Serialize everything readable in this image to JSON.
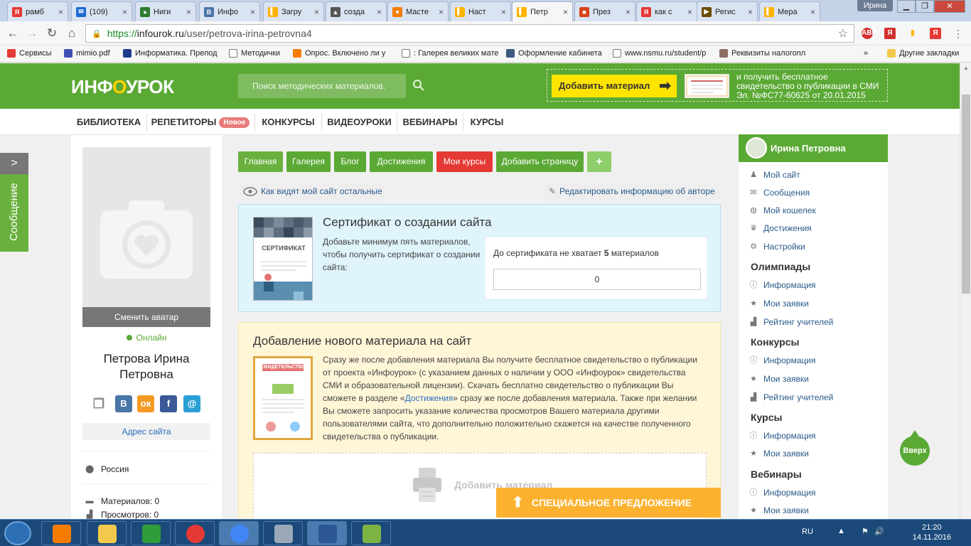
{
  "browser": {
    "tabs": [
      {
        "title": "рамб",
        "color": "#e53935",
        "glyph": "Я"
      },
      {
        "title": "(109)",
        "color": "#1e6ad4",
        "glyph": "✉"
      },
      {
        "title": "Ниги",
        "color": "#2e7d32",
        "glyph": "●"
      },
      {
        "title": "Инфо",
        "color": "#4a76a8",
        "glyph": "В"
      },
      {
        "title": "Загру",
        "color": "#ffb300",
        "glyph": "▍"
      },
      {
        "title": "созда",
        "color": "#555555",
        "glyph": "▲"
      },
      {
        "title": "Масте",
        "color": "#f57c00",
        "glyph": "♥"
      },
      {
        "title": "Наст",
        "color": "#ffb300",
        "glyph": "▍"
      },
      {
        "title": "Петр",
        "color": "#ffb300",
        "glyph": "▍"
      },
      {
        "title": "През",
        "color": "#d84315",
        "glyph": "■"
      },
      {
        "title": "как с",
        "color": "#e53935",
        "glyph": "Я"
      },
      {
        "title": "Регис",
        "color": "#6a4c00",
        "glyph": "▶"
      },
      {
        "title": "Мера",
        "color": "#ffb300",
        "glyph": "▍"
      }
    ],
    "active_tab": 8,
    "profile": "Ирина",
    "url_scheme": "https://",
    "url_host": "infourok.ru",
    "url_path": "/user/petrova-irina-petrovna4",
    "extensions": [
      "ABP",
      "Я",
      "▮",
      "Я"
    ],
    "bookmarks": [
      {
        "label": "Сервисы",
        "color": "#e53935"
      },
      {
        "label": "mimio.pdf",
        "color": "#3f51b5"
      },
      {
        "label": "Информатика. Препод",
        "color": "#1e3a8a"
      },
      {
        "label": "Методички",
        "color": "#ffffff"
      },
      {
        "label": "Опрос. Включено ли у",
        "color": "#f57c00"
      },
      {
        "label": ": Галерея великих мате",
        "color": "#ffffff"
      },
      {
        "label": "Оформление кабинета",
        "color": "#3d5a80"
      },
      {
        "label": "www.nsmu.ru/student/p",
        "color": "#ffffff"
      },
      {
        "label": "Реквизиты налогопла",
        "color": "#8d6e63"
      }
    ],
    "bookmarks_more": "»",
    "other_bookmarks": "Другие закладки"
  },
  "site": {
    "logo_a": "ИНФ",
    "logo_b": "О",
    "logo_c": "УРОК",
    "search_placeholder": "Поиск методических материалов.",
    "add_material": "Добавить материал",
    "promo_text": "и получить бесплатное свидетельство о публикации в СМИ Эл. №ФС77-60625 от 20.01.2015",
    "nav": [
      "БИБЛИОТЕКА",
      "РЕПЕТИТОРЫ",
      "КОНКУРСЫ",
      "ВИДЕОУРОКИ",
      "ВЕБИНАРЫ",
      "КУРСЫ"
    ],
    "nav_badge": "Новое"
  },
  "message_tab": {
    "arrow": ">",
    "label": "Сообщение"
  },
  "profile": {
    "change_avatar": "Сменить аватар",
    "status": "Онлайн",
    "name": "Петрова Ирина Петровна",
    "site_address": "Адрес сайта",
    "country": "Россия",
    "materials": "Материалов: 0",
    "views": "Просмотров: 0"
  },
  "page_tabs": [
    {
      "label": "Главная",
      "color": "#6ab03e"
    },
    {
      "label": "Галерея",
      "color": "#5ba935"
    },
    {
      "label": "Блог",
      "color": "#5ba935"
    },
    {
      "label": "Достижения",
      "color": "#5ba935"
    },
    {
      "label": "Мои курсы",
      "color": "#e53935"
    },
    {
      "label": "Добавить страницу",
      "color": "#5ba935"
    },
    {
      "label": "+",
      "color": "#8fcf6b"
    }
  ],
  "view_as_others": "Как видят мой сайт остальные",
  "edit_author": "Редактировать информацию об авторе",
  "certificate": {
    "title": "Сертификат о создании сайта",
    "desc": "Добавьте минимум пять материалов, чтобы получить сертификат о создании сайта:",
    "img_label": "СЕРТИФИКАТ",
    "missing_prefix": "До сертификата не хватает",
    "missing_count": "5",
    "missing_suffix": "материалов",
    "progress": "0"
  },
  "add_material": {
    "title": "Добавление нового материала на сайт",
    "desc_1": "Сразу же после добавления материала Вы получите бесплатное свидетельство о публикации от проекта «Инфоурок» (с указанием данных о наличии у ООО «Инфоурок» свидетельства СМИ и образовательной лицензии). Скачать бесплатно свидетельство о публикации Вы сможете в разделе «",
    "desc_link": "Достижения",
    "desc_2": "» сразу же после добавления материала. Также при желании Вы сможете запросить указание количества просмотров Вашего материала другими пользователями сайта, что дополнительно положительно скажется на качестве полученного свидетельства о публикации.",
    "img_label": "СВИДЕТЕЛЬСТВО",
    "dropzone_label": "Добавить материал"
  },
  "special_offer": "СПЕЦИАЛЬНОЕ ПРЕДЛОЖЕНИЕ",
  "sidebar": {
    "user": "Ирина Петровна",
    "items": [
      "Мой сайт",
      "Сообщения",
      "Мой кошелек",
      "Достижения",
      "Настройки"
    ],
    "sections": [
      {
        "title": "Олимпиады",
        "items": [
          "Информация",
          "Мои заявки",
          "Рейтинг учителей"
        ]
      },
      {
        "title": "Конкурсы",
        "items": [
          "Информация",
          "Мои заявки",
          "Рейтинг учителей"
        ]
      },
      {
        "title": "Курсы",
        "items": [
          "Информация",
          "Мои заявки"
        ]
      },
      {
        "title": "Вебинары",
        "items": [
          "Информация",
          "Мои заявки"
        ]
      }
    ]
  },
  "up_button": "Вверх",
  "taskbar": {
    "apps": [
      {
        "name": "media-player",
        "color": "#f57c00"
      },
      {
        "name": "explorer",
        "color": "#f2c94c"
      },
      {
        "name": "network",
        "color": "#2e9d3a"
      },
      {
        "name": "opera",
        "color": "#e53935"
      },
      {
        "name": "chrome",
        "color": "#4285f4"
      },
      {
        "name": "calculator",
        "color": "#9aa8b8"
      },
      {
        "name": "word",
        "color": "#2b5797"
      },
      {
        "name": "paint",
        "color": "#7cb342"
      }
    ],
    "lang": "RU",
    "time": "21:20",
    "date": "14.11.2016"
  },
  "colors": {
    "brand_green": "#5ba935",
    "logo_yellow": "#ffd200",
    "link": "#2a6ebb",
    "offer_orange": "#fcb22f"
  }
}
